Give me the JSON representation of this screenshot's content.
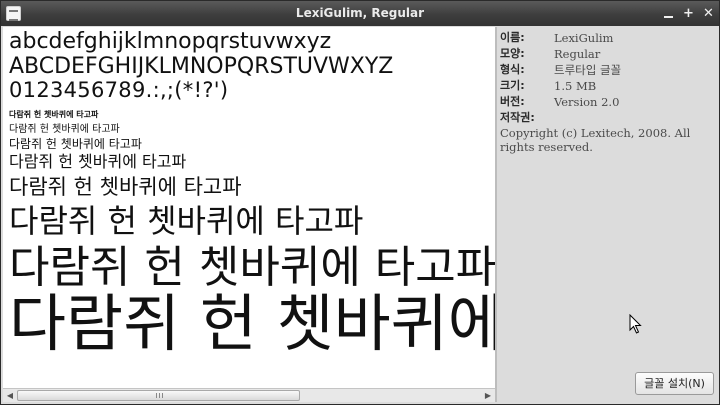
{
  "window": {
    "title": "LexiGulim, Regular",
    "controls": {
      "minimize": "minimize",
      "maximize": "+",
      "close": "✕"
    }
  },
  "preview": {
    "lines": [
      "abcdefghijklmnopqrstuvwxyz",
      "ABCDEFGHIJKLMNOPQRSTUVWXYZ",
      "0123456789.:,;(*!?')",
      "다람쥐 헌 쳇바퀴에 타고파",
      "다람쥐 헌 쳇바퀴에 타고파",
      "다람쥐 헌 쳇바퀴에 타고파",
      "다람쥐 헌 쳇바퀴에 타고파",
      "다람쥐 헌 쳇바퀴에 타고파",
      "다람쥐 헌 쳇바퀴에 타고파",
      "다람쥐 헌 쳇바퀴에 타고파",
      "다람쥐 헌 쳇바퀴에 타고파"
    ]
  },
  "info": {
    "name_label": "이름:",
    "name_value": "LexiGulim",
    "style_label": "모양:",
    "style_value": "Regular",
    "type_label": "형식:",
    "type_value": "트루타입 글꼴",
    "size_label": "크기:",
    "size_value": "1.5 MB",
    "version_label": "버전:",
    "version_value": "Version 2.0",
    "copyright_label": "저작권:",
    "copyright_value": "Copyright (c) Lexitech, 2008. All rights reserved."
  },
  "install_button": "글꼴 설치(N)",
  "scrollbar": {
    "position_fraction": 0.0
  }
}
